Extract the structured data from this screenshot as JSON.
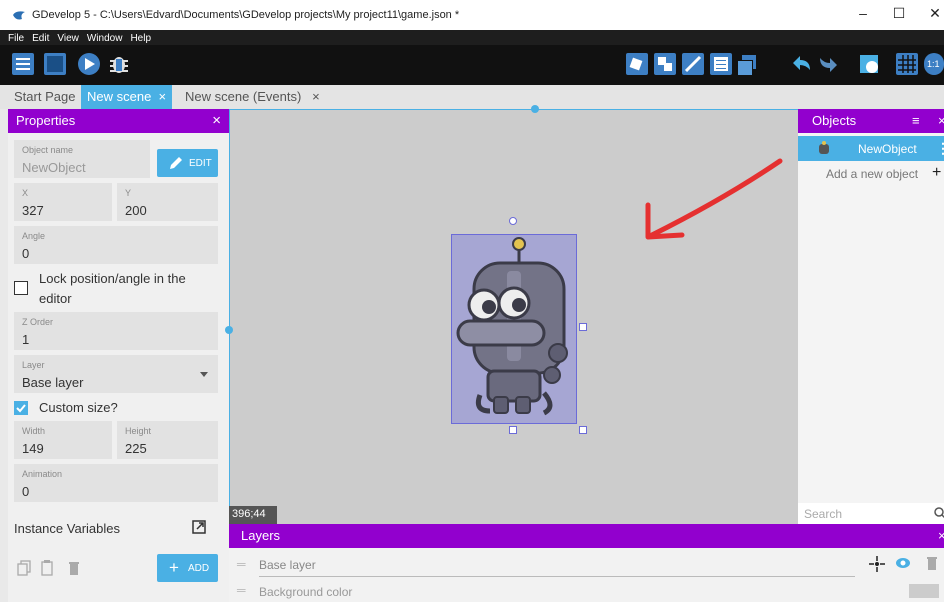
{
  "window": {
    "title": "GDevelop 5 - C:\\Users\\Edvard\\Documents\\GDevelop projects\\My project11\\game.json *",
    "minimize": "–",
    "maximize": "☐",
    "close": "✕"
  },
  "menu": [
    "File",
    "Edit",
    "View",
    "Window",
    "Help"
  ],
  "tabs": [
    {
      "label": "Start Page"
    },
    {
      "label": "New scene",
      "close": "×"
    },
    {
      "label": "New scene (Events)",
      "close": "×"
    }
  ],
  "properties": {
    "title": "Properties",
    "close": "×",
    "object_name_label": "Object name",
    "object_name": "NewObject",
    "edit_label": "EDIT",
    "x_label": "X",
    "x": "327",
    "y_label": "Y",
    "y": "200",
    "angle_label": "Angle",
    "angle": "0",
    "lock_label_1": "Lock position/angle in the",
    "lock_label_2": "editor",
    "zorder_label": "Z Order",
    "zorder": "1",
    "layer_label": "Layer",
    "layer": "Base layer",
    "custom_size_label": "Custom size?",
    "width_label": "Width",
    "width": "149",
    "height_label": "Height",
    "height": "225",
    "animation_label": "Animation",
    "animation": "0",
    "instance_vars_label": "Instance Variables",
    "add_label": "ADD",
    "add_plus": "+"
  },
  "scene": {
    "coords": "396;44"
  },
  "objects": {
    "title": "Objects",
    "close": "×",
    "filter_icon": "≡",
    "items": [
      {
        "name": "NewObject",
        "menu": "⋮"
      }
    ],
    "add_new": "Add a new object",
    "add_plus": "+",
    "search_placeholder": "Search"
  },
  "layers": {
    "title": "Layers",
    "close": "×",
    "items": [
      {
        "name": "Base layer"
      },
      {
        "name": "Background color"
      }
    ]
  },
  "colors": {
    "accent": "#9200ce",
    "tab_active": "#4ab0e4",
    "button": "#4ab0e4",
    "arrow": "#e53030"
  },
  "icons": [
    "gdevelop-logo-icon",
    "project-manager-icon",
    "scene-icon",
    "preview-icon",
    "debug-icon",
    "object-editor-icon",
    "properties-icon",
    "instances-list-icon",
    "layers-icon",
    "undo-icon",
    "redo-icon",
    "settings-icon",
    "grid-icon",
    "zoom-reset-icon"
  ]
}
